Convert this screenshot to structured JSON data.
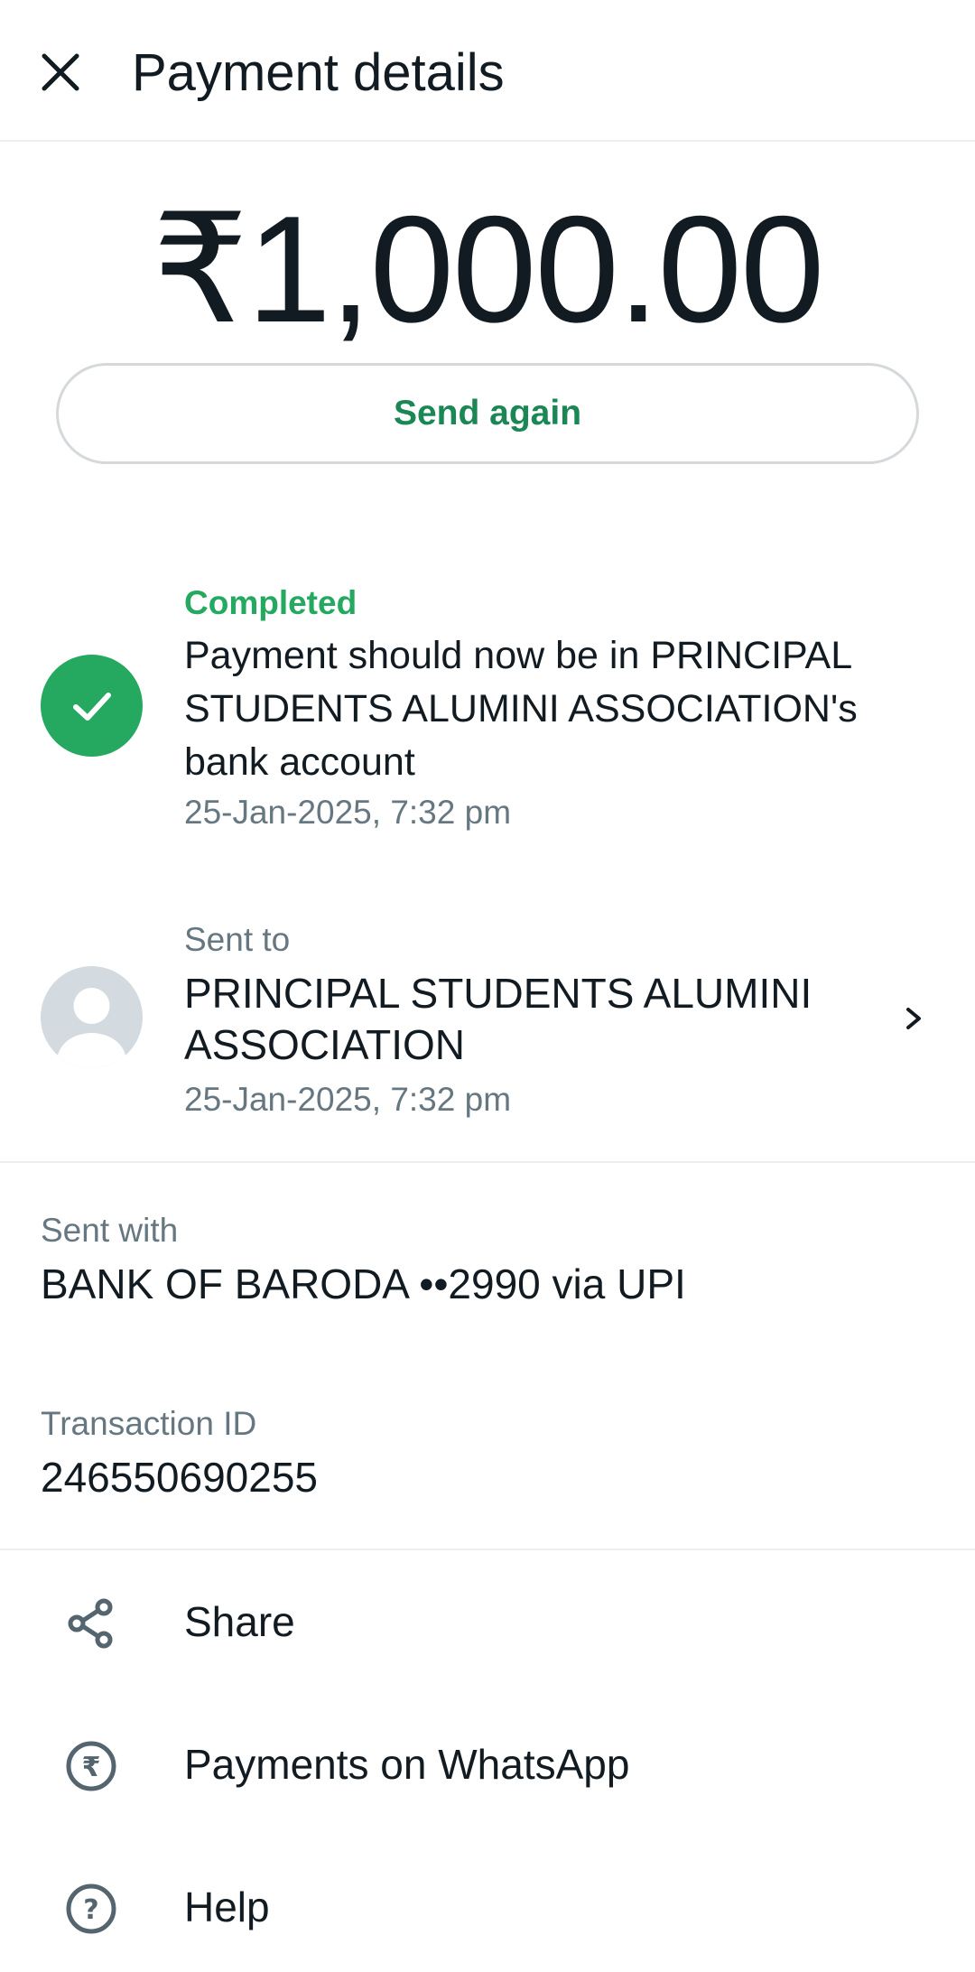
{
  "header": {
    "title": "Payment details",
    "close_icon": "close-icon"
  },
  "payment": {
    "amount": "₹1,000.00",
    "send_again_label": "Send again"
  },
  "status": {
    "label": "Completed",
    "message": "Payment should now be in PRINCIPAL STUDENTS ALUMINI ASSOCIATION's bank account",
    "time": "25-Jan-2025, 7:32 pm",
    "icon": "check-circle-icon",
    "color": "#25a85f"
  },
  "recipient": {
    "label": "Sent to",
    "name": "PRINCIPAL STUDENTS ALUMINI ASSOCIATION",
    "time": "25-Jan-2025, 7:32 pm",
    "icon": "avatar-placeholder-icon"
  },
  "sent_with": {
    "label": "Sent with",
    "value": "BANK OF BARODA ••2990 via UPI"
  },
  "transaction": {
    "label": "Transaction ID",
    "value": "246550690255"
  },
  "actions": [
    {
      "label": "Share",
      "icon": "share-icon"
    },
    {
      "label": "Payments on WhatsApp",
      "icon": "rupee-circle-icon"
    },
    {
      "label": "Help",
      "icon": "help-icon"
    }
  ],
  "colors": {
    "accent_green": "#1b8755",
    "status_green": "#25a85f",
    "secondary_text": "#667781",
    "primary_text": "#111b21"
  }
}
